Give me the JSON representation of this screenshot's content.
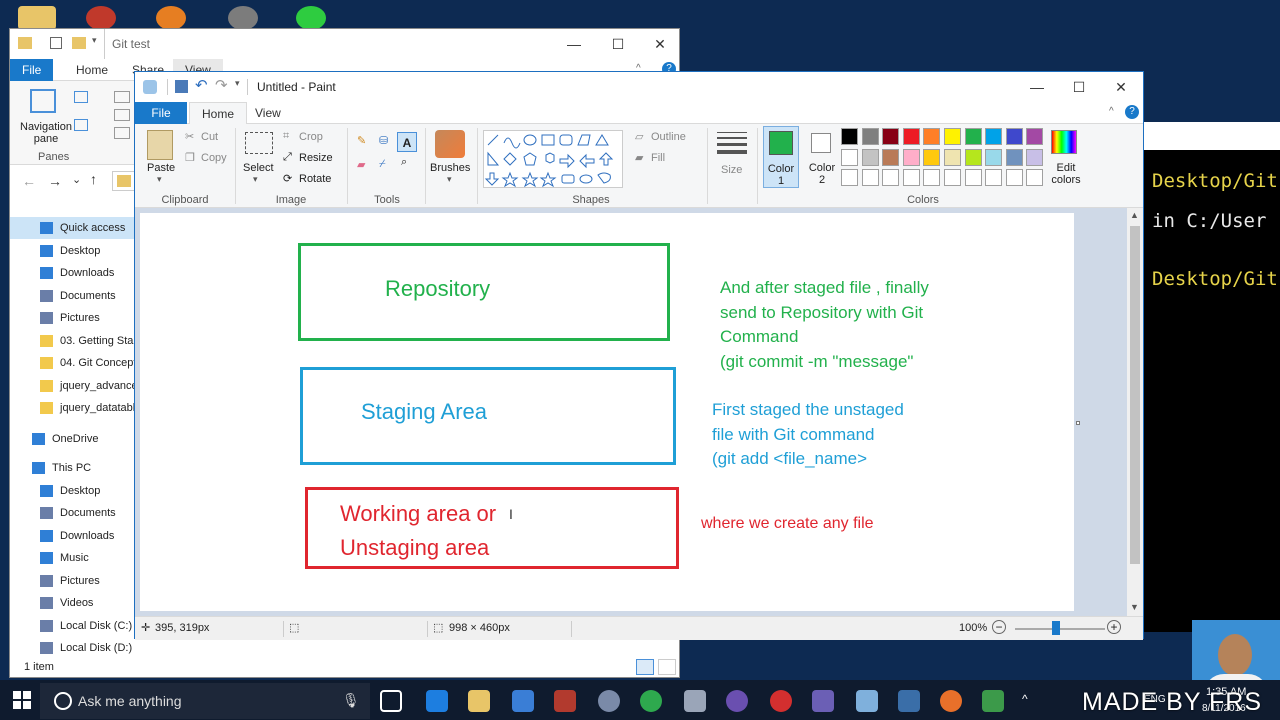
{
  "explorer": {
    "title": "Git test",
    "tabs": [
      "File",
      "Home",
      "Share",
      "View"
    ],
    "ribbon": {
      "navigation_pane": "Navigation pane",
      "panes": "Panes"
    },
    "sidebar": [
      {
        "label": "Quick access",
        "icon": "star-icon",
        "color": "#2f7fd6"
      },
      {
        "label": "Desktop",
        "icon": "desktop-icon",
        "color": "#2f7fd6"
      },
      {
        "label": "Downloads",
        "icon": "download-icon",
        "color": "#2f7fd6"
      },
      {
        "label": "Documents",
        "icon": "document-icon",
        "color": "#6a7ea8"
      },
      {
        "label": "Pictures",
        "icon": "picture-icon",
        "color": "#6a7ea8"
      },
      {
        "label": "03. Getting Star",
        "icon": "folder-icon",
        "color": "#f2c94c"
      },
      {
        "label": "04. Git Concept",
        "icon": "folder-icon",
        "color": "#f2c94c"
      },
      {
        "label": "jquery_advance",
        "icon": "folder-icon",
        "color": "#f2c94c"
      },
      {
        "label": "jquery_datatabl",
        "icon": "folder-icon",
        "color": "#f2c94c"
      },
      {
        "label": "OneDrive",
        "icon": "cloud-icon",
        "color": "#2f7fd6"
      },
      {
        "label": "This PC",
        "icon": "computer-icon",
        "color": "#2f7fd6"
      },
      {
        "label": "Desktop",
        "icon": "desktop-icon",
        "color": "#2f7fd6"
      },
      {
        "label": "Documents",
        "icon": "document-icon",
        "color": "#6a7ea8"
      },
      {
        "label": "Downloads",
        "icon": "download-icon",
        "color": "#2f7fd6"
      },
      {
        "label": "Music",
        "icon": "music-icon",
        "color": "#2f7fd6"
      },
      {
        "label": "Pictures",
        "icon": "picture-icon",
        "color": "#6a7ea8"
      },
      {
        "label": "Videos",
        "icon": "video-icon",
        "color": "#6a7ea8"
      },
      {
        "label": "Local Disk (C:)",
        "icon": "disk-icon",
        "color": "#6a7ea8"
      },
      {
        "label": "Local Disk (D:)",
        "icon": "disk-icon",
        "color": "#6a7ea8"
      }
    ],
    "status": "1 item"
  },
  "terminal": {
    "lines": [
      "Desktop/Git",
      "in C:/User",
      "Desktop/Git"
    ]
  },
  "paint": {
    "title": "Untitled - Paint",
    "tabs": [
      "File",
      "Home",
      "View"
    ],
    "clipboard": {
      "paste": "Paste",
      "cut": "Cut",
      "copy": "Copy",
      "label": "Clipboard"
    },
    "image": {
      "select": "Select",
      "crop": "Crop",
      "resize": "Resize",
      "rotate": "Rotate",
      "label": "Image"
    },
    "tools": {
      "label": "Tools"
    },
    "brushes": {
      "label": "Brushes"
    },
    "shapes": {
      "outline": "Outline",
      "fill": "Fill",
      "label": "Shapes"
    },
    "size": {
      "label": "Size"
    },
    "color1": {
      "label": "Color 1",
      "value": "#22b14c"
    },
    "color2": {
      "label": "Color 2",
      "value": "#ffffff"
    },
    "colors": {
      "label": "Colors",
      "edit": "Edit colors"
    },
    "palette": [
      "#000000",
      "#7f7f7f",
      "#880015",
      "#ed1c24",
      "#ff7f27",
      "#fff200",
      "#22b14c",
      "#00a2e8",
      "#3f48cc",
      "#a349a4",
      "#ffffff",
      "#c3c3c3",
      "#b97a57",
      "#ffaec9",
      "#ffc90e",
      "#efe4b0",
      "#b5e61d",
      "#99d9ea",
      "#7092be",
      "#c8bfe7"
    ],
    "canvas": {
      "repository": {
        "label": "Repository",
        "color": "#22b14c"
      },
      "staging": {
        "label": "Staging Area",
        "color": "#1f9fd6"
      },
      "working_line1": "Working area or",
      "working_line2": "Unstaging area",
      "working_color": "#e0262f",
      "note_repo": [
        "And after staged file , finally",
        "send to Repository  with Git",
        "Command",
        "(git commit -m \"message\""
      ],
      "note_staging": [
        "First staged the unstaged",
        "file with Git command",
        "(git add <file_name>"
      ],
      "note_working": "where we create any file"
    },
    "status": {
      "cursor": "395, 319px",
      "size": "998 × 460px",
      "zoom": "100%"
    }
  },
  "taskbar": {
    "search_placeholder": "Ask me anything",
    "watermark": "MADE  BY  FRS",
    "clock_time": "1:35 AM",
    "clock_date": "8/11/2016",
    "language": "ENG"
  }
}
